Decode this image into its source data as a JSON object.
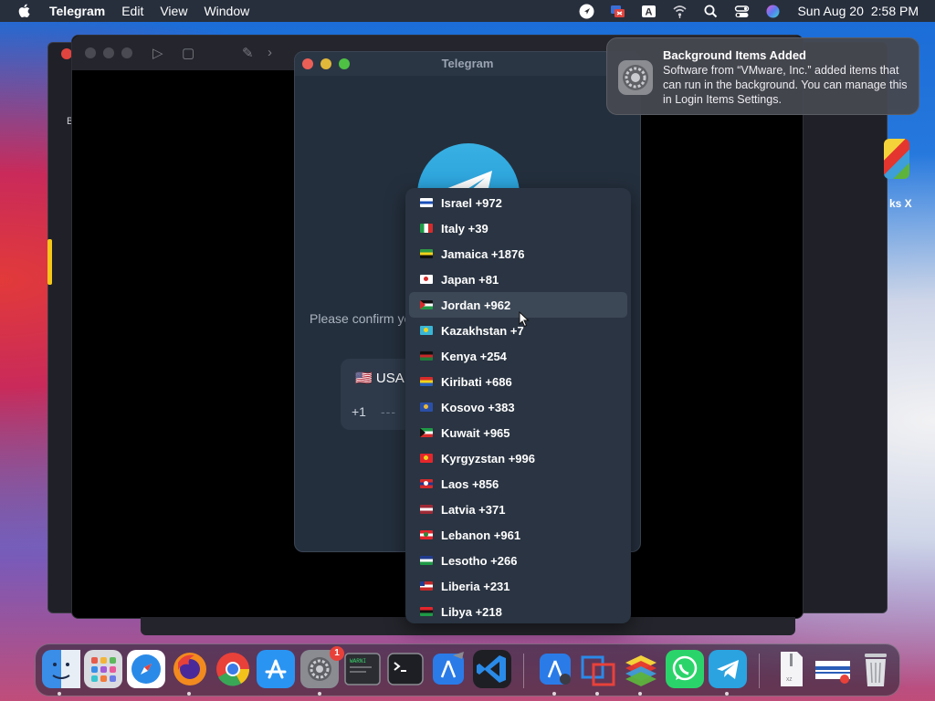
{
  "menubar": {
    "app_name": "Telegram",
    "menus": [
      "Edit",
      "View",
      "Window"
    ],
    "status_icons": [
      "location-arrow-icon",
      "screen-share-icon",
      "keyboard-input-icon",
      "wifi-icon",
      "search-icon",
      "control-center-icon",
      "siri-icon"
    ],
    "input_letter": "A",
    "date": "Sun Aug 20",
    "time": "2:58 PM"
  },
  "background": {
    "side_text": "B",
    "desktop_item_label": "ks X"
  },
  "telegram": {
    "window_title": "Telegram",
    "confirm_text": "Please confirm yo",
    "country_name": "USA",
    "country_flag": "🇺🇸",
    "country_code": "+1",
    "phone_placeholder": "---"
  },
  "dropdown": {
    "hovered_index": 4,
    "countries": [
      {
        "label": "Israel +972",
        "flag_colors": [
          "#ffffff",
          "#1b4fb8",
          "#ffffff"
        ]
      },
      {
        "label": "Italy +39",
        "flag_colors": [
          "#1f9a46",
          "#ffffff",
          "#d62b2b"
        ],
        "vertical": true
      },
      {
        "label": "Jamaica +1876",
        "flag_colors": [
          "#2d9a44",
          "#f2d31b",
          "#111111"
        ]
      },
      {
        "label": "Japan +81",
        "flag_colors": [
          "#ffffff",
          "#ffffff",
          "#ffffff"
        ],
        "dot": "#d62b2b"
      },
      {
        "label": "Jordan +962",
        "flag_colors": [
          "#111111",
          "#ffffff",
          "#1f9a46"
        ],
        "triangle": "#d62b2b"
      },
      {
        "label": "Kazakhstan +7",
        "flag_colors": [
          "#39b6d6",
          "#39b6d6",
          "#39b6d6"
        ],
        "dot": "#f2d31b"
      },
      {
        "label": "Kenya +254",
        "flag_colors": [
          "#111111",
          "#c62828",
          "#1f7a3a"
        ]
      },
      {
        "label": "Kiribati +686",
        "flag_colors": [
          "#d62b2b",
          "#f2d31b",
          "#2a5db8"
        ]
      },
      {
        "label": "Kosovo +383",
        "flag_colors": [
          "#2a4fa8",
          "#2a4fa8",
          "#2a4fa8"
        ],
        "dot": "#e8b83a"
      },
      {
        "label": "Kuwait +965",
        "flag_colors": [
          "#1f9a46",
          "#ffffff",
          "#d62b2b"
        ],
        "triangle": "#111111"
      },
      {
        "label": "Kyrgyzstan +996",
        "flag_colors": [
          "#e3262c",
          "#e3262c",
          "#e3262c"
        ],
        "dot": "#f2d31b"
      },
      {
        "label": "Laos +856",
        "flag_colors": [
          "#d62b2b",
          "#20388f",
          "#d62b2b"
        ],
        "dot": "#ffffff"
      },
      {
        "label": "Latvia +371",
        "flag_colors": [
          "#9e2a36",
          "#ffffff",
          "#9e2a36"
        ]
      },
      {
        "label": "Lebanon +961",
        "flag_colors": [
          "#e3262c",
          "#ffffff",
          "#e3262c"
        ],
        "dot": "#2e8b3a"
      },
      {
        "label": "Lesotho +266",
        "flag_colors": [
          "#1f3b8f",
          "#ffffff",
          "#1f9a46"
        ]
      },
      {
        "label": "Liberia +231",
        "flag_colors": [
          "#c62828",
          "#ffffff",
          "#c62828"
        ],
        "canton": "#1f3b8f"
      },
      {
        "label": "Libya +218",
        "flag_colors": [
          "#e3262c",
          "#111111",
          "#1f9a46"
        ]
      }
    ]
  },
  "notification": {
    "title": "Background Items Added",
    "body": "Software from “VMware, Inc.” added items that can run in the background. You can manage this in Login Items Settings.",
    "app_icon": "system-settings-icon"
  },
  "dock": {
    "apps": [
      "finder",
      "launchpad",
      "safari",
      "firefox",
      "chrome",
      "app-store",
      "system-settings",
      "console",
      "terminal",
      "xcode",
      "vscode",
      "xcode-instruments",
      "vmware-fusion",
      "bluestacks",
      "whatsapp",
      "telegram",
      "archive",
      "preview-file",
      "trash"
    ],
    "settings_badge": "1"
  },
  "colors": {
    "telegram_blue": "#2aa3e0",
    "window_bg": "#242f3d",
    "dropdown_bg": "#2a3442"
  }
}
